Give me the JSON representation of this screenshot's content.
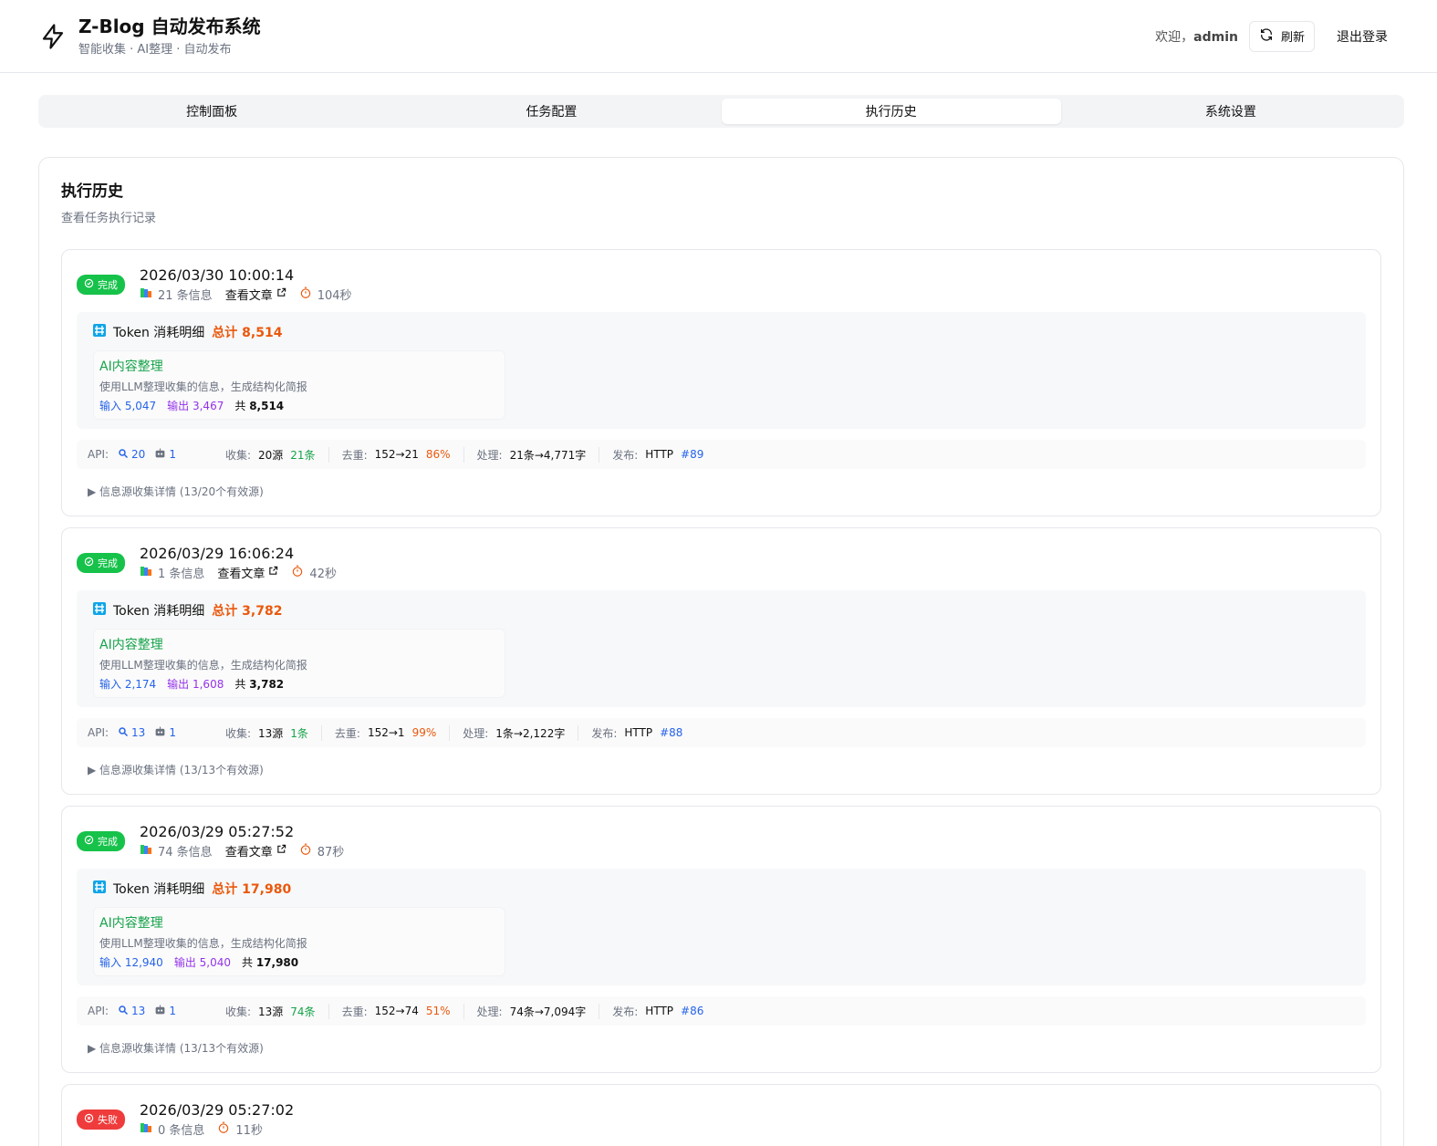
{
  "header": {
    "title": "Z-Blog 自动发布系统",
    "subtitle": "智能收集 · AI整理 · 自动发布",
    "welcome_prefix": "欢迎，",
    "username": "admin",
    "refresh_label": "刷新",
    "logout_label": "退出登录"
  },
  "tabs": [
    {
      "label": "控制面板",
      "active": false
    },
    {
      "label": "任务配置",
      "active": false
    },
    {
      "label": "执行历史",
      "active": true
    },
    {
      "label": "系统设置",
      "active": false
    }
  ],
  "page": {
    "title": "执行历史",
    "subtitle": "查看任务执行记录"
  },
  "records": [
    {
      "status": "完成",
      "time": "2026/03/30 10:00:14",
      "info_count": "21 条信息",
      "view_link": "查看文章",
      "duration": "104秒",
      "token_title": "Token 消耗明细",
      "token_total": "总计 8,514",
      "stage_name": "AI内容整理",
      "stage_desc": "使用LLM整理收集的信息，生成结构化简报",
      "tok_in": "输入 5,047",
      "tok_out": "输出 3,467",
      "tok_all_label": "共",
      "tok_all": "8,514",
      "api_label": "API:",
      "api_search": "20",
      "api_ai": "1",
      "collect_label": "收集:",
      "collect_src": "20源",
      "collect_n": "21条",
      "dedup_label": "去重:",
      "dedup": "152→21",
      "dedup_pct": "86%",
      "process_label": "处理:",
      "process": "21条→4,771字",
      "publish_label": "发布:",
      "publish": "HTTP",
      "publish_id": "#89",
      "details": "▶ 信息源收集详情 (13/20个有效源)"
    },
    {
      "status": "完成",
      "time": "2026/03/29 16:06:24",
      "info_count": "1 条信息",
      "view_link": "查看文章",
      "duration": "42秒",
      "token_title": "Token 消耗明细",
      "token_total": "总计 3,782",
      "stage_name": "AI内容整理",
      "stage_desc": "使用LLM整理收集的信息，生成结构化简报",
      "tok_in": "输入 2,174",
      "tok_out": "输出 1,608",
      "tok_all_label": "共",
      "tok_all": "3,782",
      "api_label": "API:",
      "api_search": "13",
      "api_ai": "1",
      "collect_label": "收集:",
      "collect_src": "13源",
      "collect_n": "1条",
      "dedup_label": "去重:",
      "dedup": "152→1",
      "dedup_pct": "99%",
      "process_label": "处理:",
      "process": "1条→2,122字",
      "publish_label": "发布:",
      "publish": "HTTP",
      "publish_id": "#88",
      "details": "▶ 信息源收集详情 (13/13个有效源)"
    },
    {
      "status": "完成",
      "time": "2026/03/29 05:27:52",
      "info_count": "74 条信息",
      "view_link": "查看文章",
      "duration": "87秒",
      "token_title": "Token 消耗明细",
      "token_total": "总计 17,980",
      "stage_name": "AI内容整理",
      "stage_desc": "使用LLM整理收集的信息，生成结构化简报",
      "tok_in": "输入 12,940",
      "tok_out": "输出 5,040",
      "tok_all_label": "共",
      "tok_all": "17,980",
      "api_label": "API:",
      "api_search": "13",
      "api_ai": "1",
      "collect_label": "收集:",
      "collect_src": "13源",
      "collect_n": "74条",
      "dedup_label": "去重:",
      "dedup": "152→74",
      "dedup_pct": "51%",
      "process_label": "处理:",
      "process": "74条→7,094字",
      "publish_label": "发布:",
      "publish": "HTTP",
      "publish_id": "#86",
      "details": "▶ 信息源收集详情 (13/13个有效源)"
    }
  ],
  "last_record": {
    "status": "失败",
    "time": "2026/03/29 05:27:02",
    "info_count": "0 条信息",
    "duration": "11秒"
  },
  "icons": {
    "brand": "lightning-icon",
    "refresh": "refresh-icon",
    "status_ok": "check-circle-icon",
    "status_fail": "x-circle-icon",
    "info": "books-icon",
    "external": "external-link-icon",
    "timer": "stopwatch-icon",
    "token": "abacus-icon",
    "search": "magnifier-icon",
    "robot": "robot-icon"
  },
  "colors": {
    "success": "#16c24a",
    "danger": "#ef3b3b",
    "token_total": "#ea580c",
    "stage_green": "#16a34a",
    "input_blue": "#2563eb",
    "output_purple": "#9333ea"
  }
}
